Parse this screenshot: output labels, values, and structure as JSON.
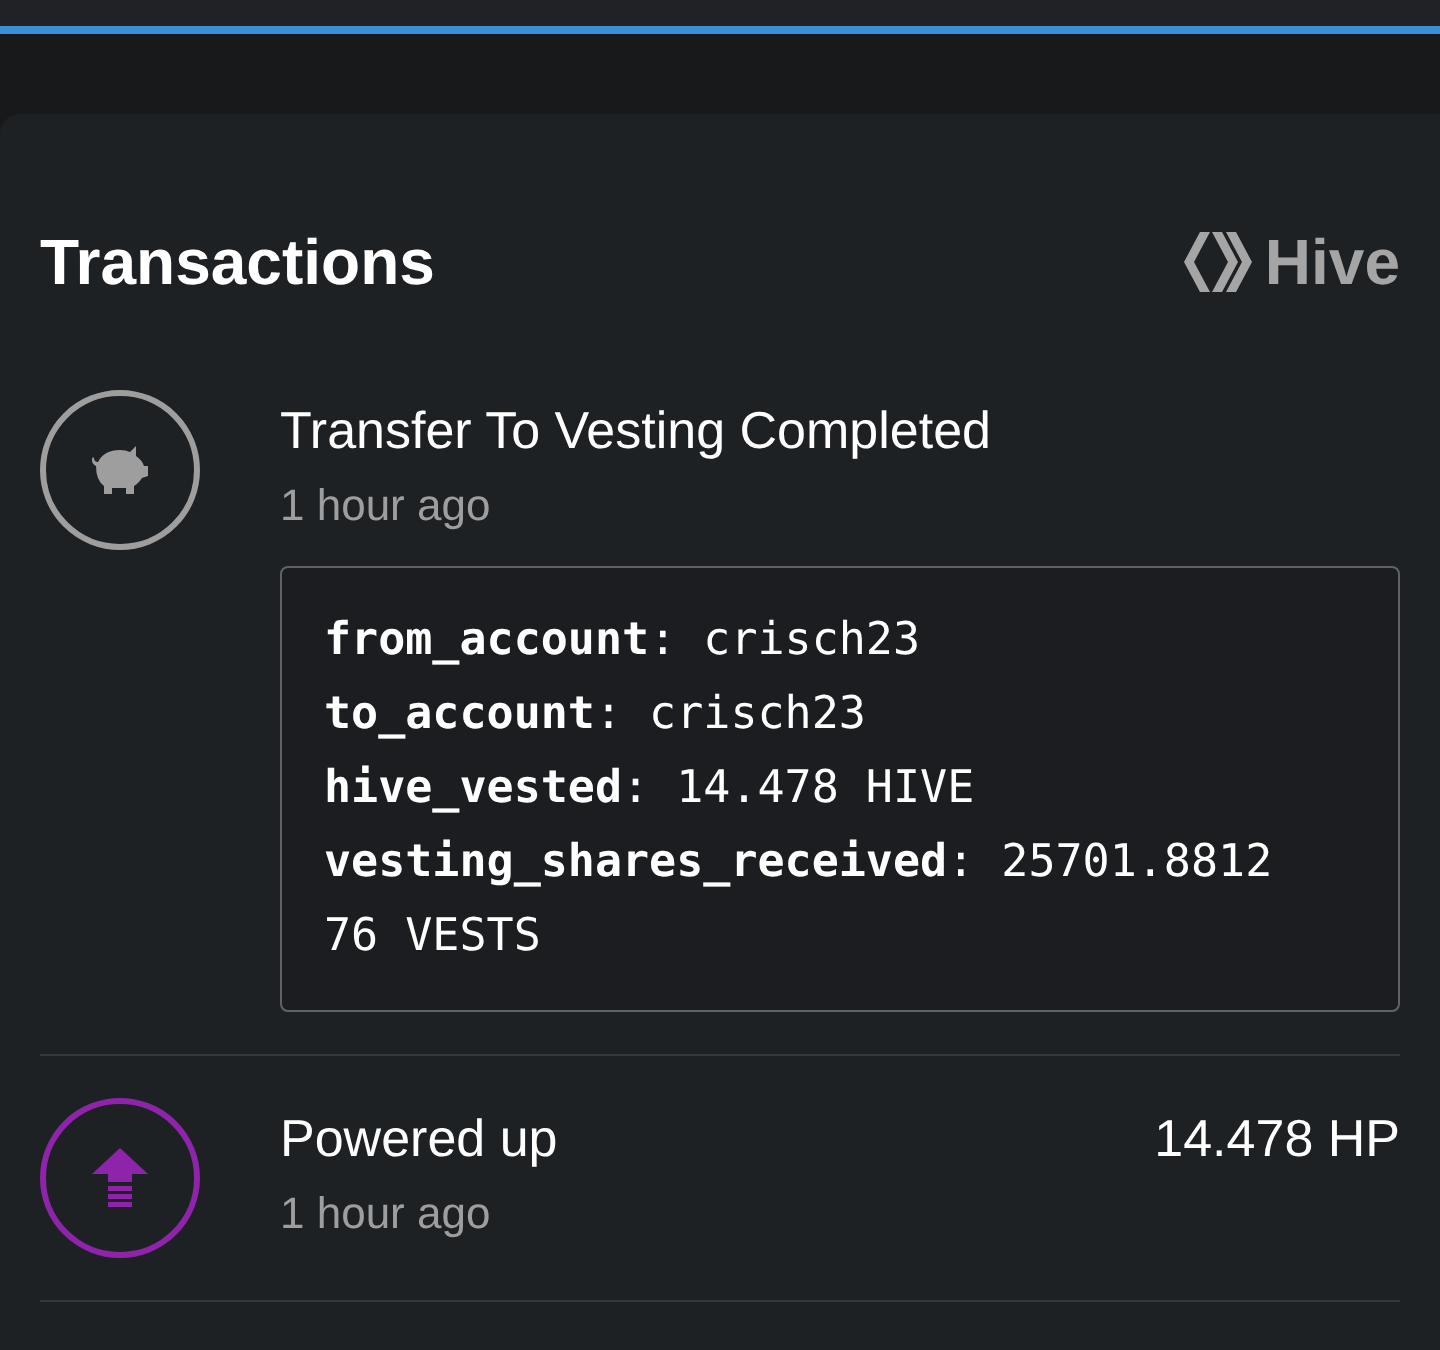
{
  "header": {
    "title": "Transactions",
    "brand": "Hive"
  },
  "transactions": [
    {
      "kind": "vesting",
      "color": "#9e9e9e",
      "title": "Transfer To Vesting Completed",
      "time": "1 hour ago",
      "details": [
        "**from_account**: crisch23",
        "**to_account**: crisch23",
        "**hive_vested**: 14.478 HIVE",
        "**vesting_shares_received**: 25701.881276 VESTS"
      ]
    },
    {
      "kind": "power_up",
      "color": "#8e24aa",
      "title": "Powered up",
      "time": "1 hour ago",
      "amount": "14.478 HP"
    }
  ]
}
